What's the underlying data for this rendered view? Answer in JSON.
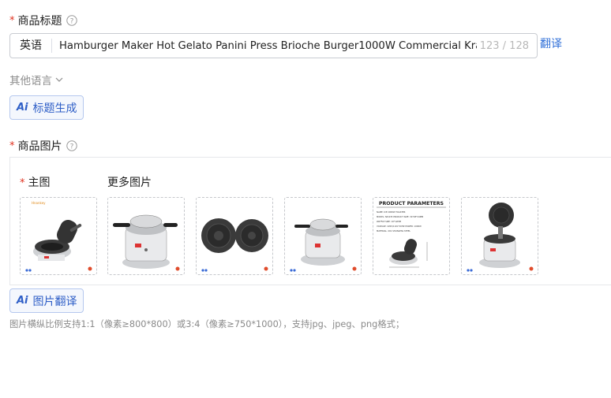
{
  "product_title": {
    "label": "商品标题",
    "language": "英语",
    "value": "Hamburger Maker Hot Gelato Panini Press Brioche Burger1000W Commercial Krapfen \\",
    "counter": "123 / 128",
    "translate_link": "翻译"
  },
  "other_languages": {
    "label": "其他语言"
  },
  "ai_title_button": {
    "ai_mark": "Ai",
    "label": "标题生成"
  },
  "product_images": {
    "label": "商品图片",
    "main_label": "主图",
    "more_label": "更多图片",
    "thumbnails": [
      {
        "name": "waffle-maker-open",
        "brand": "Hnankey"
      },
      {
        "name": "waffle-maker-closed",
        "brand": ""
      },
      {
        "name": "waffle-plates",
        "brand": ""
      },
      {
        "name": "waffle-maker-closed-angle",
        "brand": ""
      },
      {
        "name": "product-parameters",
        "heading": "PRODUCT PARAMETERS",
        "specs": [
          "NAME: ICE CREAM TOASTER",
          "MODEL: NP-635   PRODUCT SIZE: 34*28*24MM",
          "WAFFLE SIZE: 10*12MM",
          "VOLTAGE: 220V/110V 50HZ   POWER: 1000W",
          "MATERIAL: 201 STAINLESS STEEL"
        ]
      },
      {
        "name": "waffle-maker-open-front",
        "brand": ""
      }
    ]
  },
  "ai_image_button": {
    "ai_mark": "Ai",
    "label": "图片翻译"
  },
  "hint": "图片横纵比例支持1:1（像素≥800*800）或3:4（像素≥750*1000），支持jpg、jpeg、png格式；",
  "colors": {
    "accent": "#2f6fd8",
    "required": "#e0301e",
    "muted": "#8c8c8c"
  }
}
